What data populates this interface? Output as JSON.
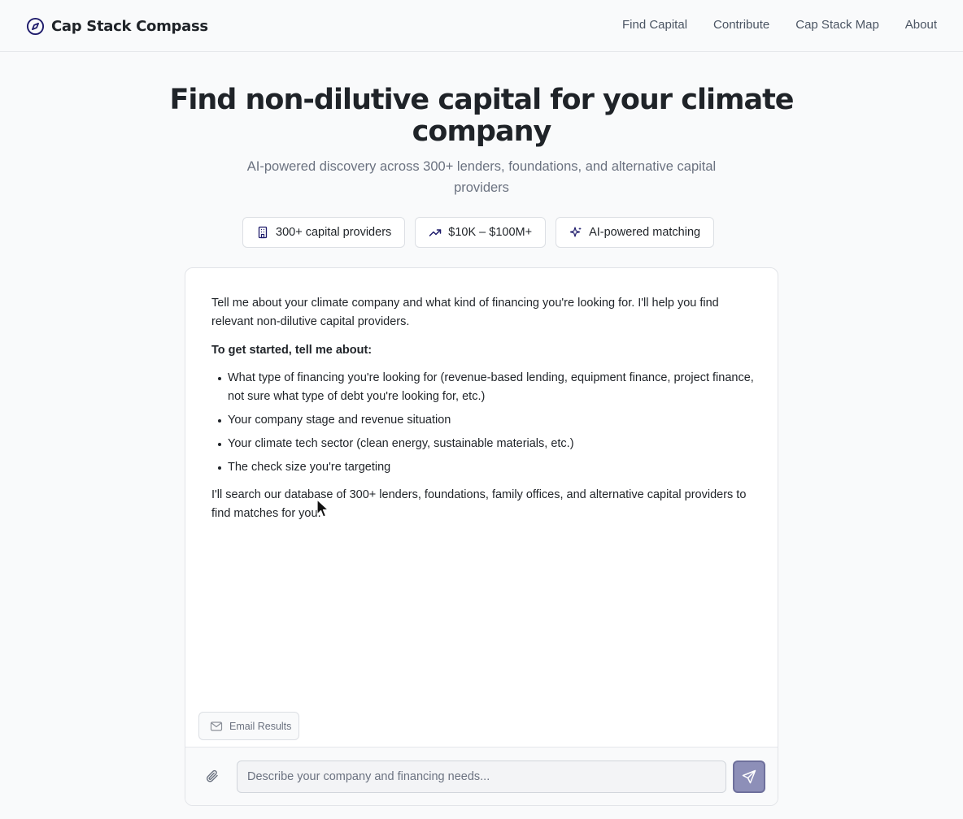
{
  "header": {
    "brand": {
      "name": "Cap Stack Compass",
      "icon": "compass-icon"
    },
    "nav": [
      "Find Capital",
      "Contribute",
      "Cap Stack Map",
      "About"
    ]
  },
  "hero": {
    "title": "Find non-dilutive capital for your climate company",
    "subtitle": "AI-powered discovery across 300+ lenders, foundations, and alternative capital providers",
    "pills": [
      {
        "icon": "building-icon",
        "label": "300+ capital providers"
      },
      {
        "icon": "trending-up-icon",
        "label": "$10K – $100M+"
      },
      {
        "icon": "sparkles-icon",
        "label": "AI-powered matching"
      }
    ]
  },
  "chat": {
    "message": {
      "intro": "Tell me about your climate company and what kind of financing you're looking for. I'll help you find relevant non-dilutive capital providers.",
      "heading": "To get started, tell me about:",
      "items": [
        "What type of financing you're looking for (revenue-based lending, equipment finance, project finance, not sure what type of debt you're looking for, etc.)",
        "Your company stage and revenue situation",
        "Your climate tech sector (clean energy, sustainable materials, etc.)",
        "The check size you're targeting"
      ],
      "outro": "I'll search our database of 300+ lenders, foundations, family offices, and alternative capital providers to find matches for you."
    },
    "email_button": {
      "label": "Email Results",
      "icon": "mail-icon"
    },
    "input": {
      "placeholder": "Describe your company and financing needs...",
      "value": ""
    },
    "attach_icon": "paperclip-icon",
    "send_icon": "send-icon"
  },
  "colors": {
    "page_bg": "#f9fafb",
    "brand_accent": "#1e1b6b",
    "send_button": "#8d8fb8",
    "muted_text": "#6b7280"
  }
}
